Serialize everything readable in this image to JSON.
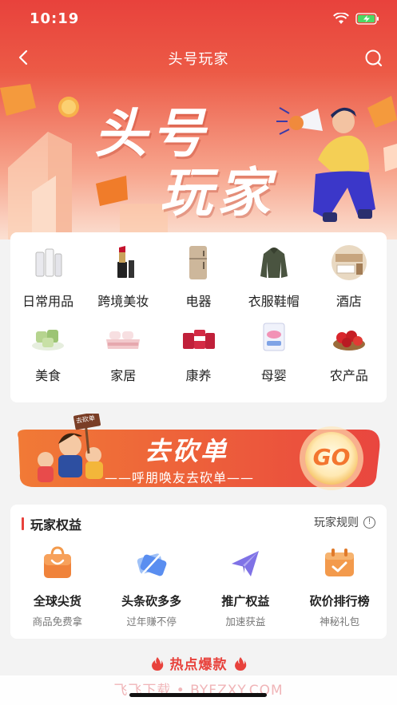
{
  "status_bar": {
    "time": "10:19"
  },
  "nav": {
    "title": "头号玩家"
  },
  "hero": {
    "line1": "头号",
    "line2": "玩家"
  },
  "categories": [
    {
      "label": "日常用品",
      "icon": "daily-goods-icon"
    },
    {
      "label": "跨境美妆",
      "icon": "lipstick-icon"
    },
    {
      "label": "电器",
      "icon": "refrigerator-icon"
    },
    {
      "label": "衣服鞋帽",
      "icon": "jacket-icon"
    },
    {
      "label": "酒店",
      "icon": "hotel-room-icon"
    },
    {
      "label": "美食",
      "icon": "food-icon"
    },
    {
      "label": "家居",
      "icon": "bedding-icon"
    },
    {
      "label": "康养",
      "icon": "supplement-icon"
    },
    {
      "label": "母婴",
      "icon": "diaper-icon"
    },
    {
      "label": "农产品",
      "icon": "fruit-icon"
    }
  ],
  "bargain_banner": {
    "title": "去砍单",
    "subtitle": "——呼朋唤友去砍单——",
    "go": "GO",
    "sign": "去砍单"
  },
  "rights": {
    "title": "玩家权益",
    "rules_label": "玩家规则",
    "items": [
      {
        "name": "全球尖货",
        "sub": "商品免费拿",
        "icon": "shopping-bag-icon"
      },
      {
        "name": "头条砍多多",
        "sub": "过年赚不停",
        "icon": "coupon-icon"
      },
      {
        "name": "推广权益",
        "sub": "加速获益",
        "icon": "paper-plane-icon"
      },
      {
        "name": "砍价排行榜",
        "sub": "神秘礼包",
        "icon": "calendar-check-icon"
      }
    ]
  },
  "hot_section": {
    "title": "热点爆款"
  },
  "watermark": "飞飞下载 • BYFZXY.COM",
  "colors": {
    "brand_red": "#e8423c",
    "orange": "#f39a4c",
    "purple": "#7f72e6",
    "blue": "#5a8ef0"
  }
}
